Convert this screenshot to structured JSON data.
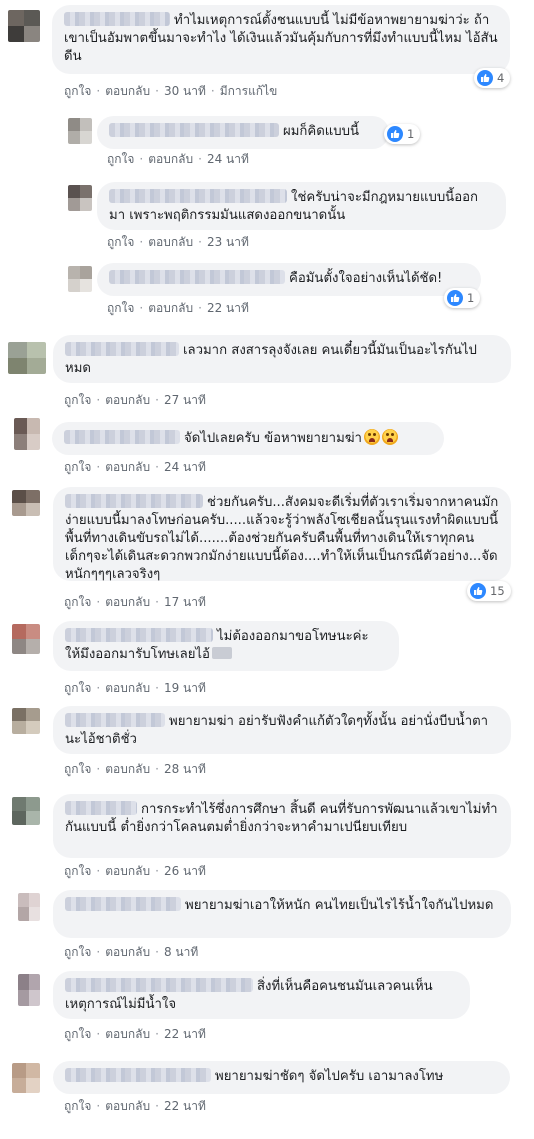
{
  "actions": {
    "like": "ถูกใจ",
    "reply": "ตอบกลับ"
  },
  "comments": [
    {
      "text": "ทำไมเหตุการณ์ตั้งชนแบบนี้ ไม่มีข้อหาพยายามฆ่าว่ะ ถ้าเขาเป็นอัมพาตขึ้นมาจะทำไง ได้เงินแล้วมันคุ้มกับการที่มึงทำแบบนี้ไหม ไอ้สันดีน",
      "reactions": "4",
      "time": "30 นาที",
      "edited": "มีการแก้ไข"
    },
    {
      "text": "ผมก็คิดแบบนี้",
      "reactions": "1",
      "time": "24 นาที"
    },
    {
      "text": "ใช่ครับน่าจะมีกฎหมายแบบนี้ออกมา เพราะพฤติกรรมมันแสดงออกขนาดนั้น",
      "time": "23 นาที"
    },
    {
      "text": "คือมันตั้งใจอย่างเห็นได้ชัด!",
      "reactions": "1",
      "time": "22 นาที"
    },
    {
      "text": "เลวมาก สงสารลุงจังเลย คนเดี๋ยวนี้มันเป็นอะไรกันไปหมด",
      "time": "27 นาที"
    },
    {
      "text": "จัดไปเลยครับ ข้อหาพยายามฆ่า",
      "time": "24 นาที"
    },
    {
      "text": "ช่วยกันครับ...สังคมจะดีเริ่มที่ตัวเราเริ่มจากหาคนมักง่ายแบบนี้มาลงโทษก่อนครับ.....แล้วจะรู้ว่าพลังโซเชียลนั้นรุนแรงทำผิดแบบนี้พื้นที่ทางเดินขับรถไม่ได้.......ต้องช่วยกันครับคืนพื้นที่ทางเดินให้เราทุกคนเด็กๆจะได้เดินสะดวกพวกมักง่ายแบบนี้ต้อง....ทำให้เห็นเป็นกรณีตัวอย่าง...จัดหนักๆๆๆเลวจริงๆ",
      "reactions": "15",
      "time": "17 นาที"
    },
    {
      "text": "ไม่ต้องออกมาขอโทษนะค่ะ ให้มึงออกมารับโทษเลยไอ้",
      "time": "19 นาที"
    },
    {
      "text": "พยายามฆ่า อย่ารับฟังคำแก้ตัวใดๆทั้งนั้น อย่านั่งบีบน้ำตานะไอ้ชาติชั่ว",
      "time": "28 นาที"
    },
    {
      "text": "การกระทำไร้ซึ่งการศึกษา สิ้นดี คนที่รับการพัฒนาแล้วเขาไม่ทำกันแบบนี้ ต่ำยิ่งกว่าโคลนตมต่ำยิ่งกว่าจะหาคำมาเปนียบเทียบ",
      "time": "26 นาที"
    },
    {
      "text": "พยายามฆ่าเอาให้หนัก คนไทยเป็นไรไร้น้ำใจกันไปหมด",
      "time": "8 นาที"
    },
    {
      "text": "สิ่งที่เห็นคือคนชนมันเลวคนเห็นเหตุการณ์ไม่มีน้ำใจ",
      "time": "22 นาที"
    },
    {
      "text": "พยายามฆ่าชัดๆ จัดไปครับ เอามาลงโทษ",
      "time": "22 นาที"
    }
  ],
  "colors": {
    "bubble": "#f2f3f5",
    "link": "#606770",
    "like_blue": "#2d88ff"
  }
}
